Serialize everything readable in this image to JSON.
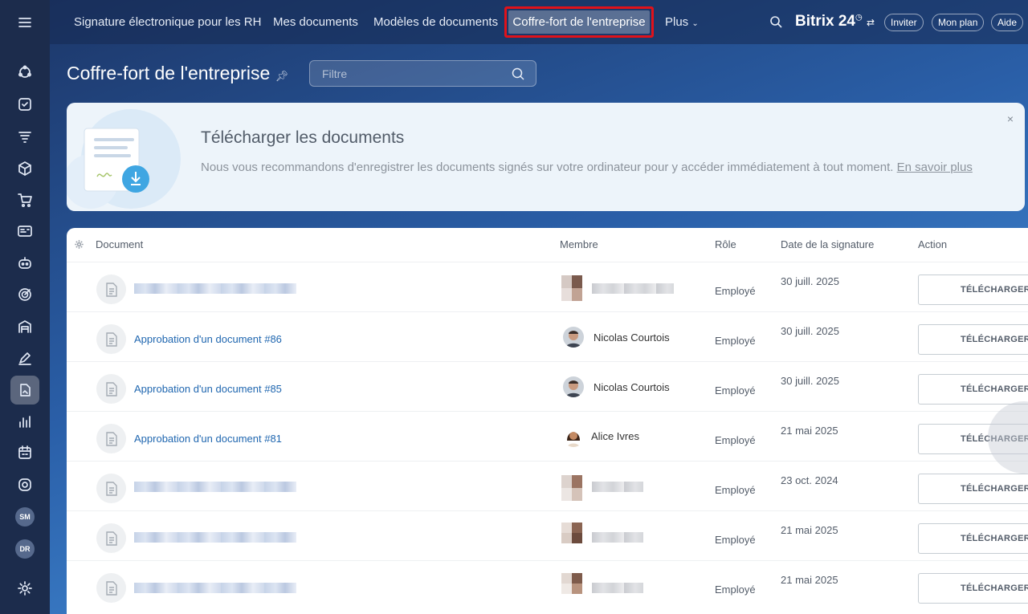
{
  "topnav": {
    "items": [
      "Signature électronique pour les RH",
      "Mes documents",
      "Modèles de documents"
    ],
    "active": "Coffre-fort de l'entreprise",
    "more": "Plus",
    "brand": "Bitrix 24",
    "invite": "Inviter",
    "plan": "Mon plan",
    "help": "Aide"
  },
  "sidebar": {
    "icons": [
      "hub-icon",
      "tasks-icon",
      "filter-icon",
      "box-icon",
      "cart-icon",
      "id-card-icon",
      "robot-icon",
      "target-icon",
      "warehouse-icon",
      "sign-icon",
      "signature-doc-icon",
      "analytics-icon",
      "calendar-icon",
      "timer-icon"
    ],
    "active_icon": "signature-doc-icon",
    "avatars": [
      "SM",
      "DR"
    ]
  },
  "page": {
    "title": "Coffre-fort de l'entreprise",
    "filter_placeholder": "Filtre"
  },
  "banner": {
    "title": "Télécharger les documents",
    "text": "Nous vous recommandons d'enregistrer les documents signés sur votre ordinateur pour y accéder immédiatement à tout moment.",
    "link": "En savoir plus",
    "close": "×"
  },
  "table": {
    "headers": {
      "document": "Document",
      "member": "Membre",
      "role": "Rôle",
      "date": "Date de la signature",
      "action": "Action"
    },
    "rows": [
      {
        "doc": "",
        "member": "",
        "role": "Employé",
        "date": "30 juill. 2025",
        "action": "TÉLÉCHARGER",
        "redacted": true
      },
      {
        "doc": "Approbation d'un document #86",
        "member": "Nicolas Courtois",
        "role": "Employé",
        "date": "30 juill. 2025",
        "action": "TÉLÉCHARGER",
        "redacted": false
      },
      {
        "doc": "Approbation d'un document #85",
        "member": "Nicolas Courtois",
        "role": "Employé",
        "date": "30 juill. 2025",
        "action": "TÉLÉCHARGER",
        "redacted": false
      },
      {
        "doc": "Approbation d'un document #81",
        "member": "Alice Ivres",
        "role": "Employé",
        "date": "21 mai 2025",
        "action": "TÉLÉCHARGER",
        "redacted": false
      },
      {
        "doc": "",
        "member": "",
        "role": "Employé",
        "date": "23 oct. 2024",
        "action": "TÉLÉCHARGER",
        "redacted": true
      },
      {
        "doc": "",
        "member": "",
        "role": "Employé",
        "date": "21 mai 2025",
        "action": "TÉLÉCHARGER",
        "redacted": true
      },
      {
        "doc": "",
        "member": "",
        "role": "Employé",
        "date": "21 mai 2025",
        "action": "TÉLÉCHARGER",
        "redacted": true
      }
    ]
  },
  "colors": {
    "accent_link": "#2067b0",
    "highlight_border": "#e0121a",
    "rail": "#1c2c4c"
  }
}
